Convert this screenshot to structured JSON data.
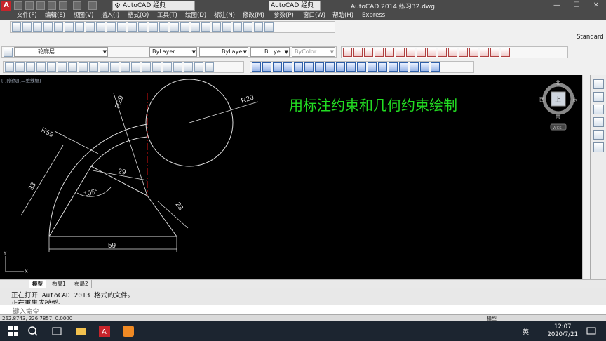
{
  "app": {
    "workspace": "AutoCAD 经典",
    "mini_workspace": "AutoCAD 经典",
    "title": "AutoCAD 2014    练习32.dwg"
  },
  "menu": [
    "文件(F)",
    "编辑(E)",
    "视图(V)",
    "插入(I)",
    "格式(O)",
    "工具(T)",
    "绘图(D)",
    "标注(N)",
    "修改(M)",
    "参数(P)",
    "窗口(W)",
    "帮助(H)",
    "Express"
  ],
  "properties": {
    "layer": "轮廓层",
    "color": "ByLayer",
    "linetype": "ByLayer",
    "lineweight": "B...ye",
    "plotstyle": "ByColor",
    "text_style": "Standard"
  },
  "viewport": {
    "label": "[-][俯视][二维线框]",
    "annotation": "用标注约束和几何约束绘制",
    "annotation_color": "#22dd22",
    "dims": {
      "r20": "R20",
      "r29": "R29",
      "r59": "R59",
      "d29": "29",
      "d33": "33",
      "ang": "105°",
      "d23": "23",
      "d59": "59"
    },
    "viewcube": {
      "north": "北",
      "south": "南",
      "east": "东",
      "west": "西",
      "top": "上",
      "wcs": "WCS"
    },
    "ucs_y": "Y",
    "ucs_x": "X"
  },
  "tabs": [
    "模型",
    "布局1",
    "布局2"
  ],
  "command": {
    "line1": "正在打开 AutoCAD 2013 格式的文件。",
    "line2": "正在重生成模型。",
    "prompt": "键入命令"
  },
  "status": {
    "coords": "262.8743, 226.7857, 0.0000",
    "model": "模型"
  },
  "taskbar": {
    "time": "12:07",
    "date": "2020/7/21",
    "ime": "英"
  }
}
